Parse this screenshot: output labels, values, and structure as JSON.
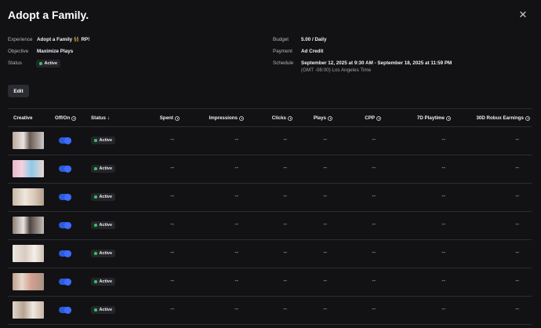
{
  "header": {
    "title": "Adopt a Family.",
    "close_icon": "close-icon"
  },
  "details": {
    "experience_label": "Experience",
    "experience_value": "Adopt a Family 👯 RP!",
    "objective_label": "Objective",
    "objective_value": "Maximize Plays",
    "status_label": "Status",
    "status_value": "Active",
    "budget_label": "Budget",
    "budget_value": "5.00 / Daily",
    "payment_label": "Payment",
    "payment_value": "Ad Credit",
    "schedule_label": "Schedule",
    "schedule_value": "September 12, 2025 at 9:30 AM - September 18, 2025 at 11:59 PM",
    "schedule_tz": "(GMT -08:00) Los Angeles Time"
  },
  "edit_label": "Edit",
  "table": {
    "columns": {
      "creative": "Creative",
      "onoff": "Off/On",
      "status": "Status",
      "spent": "Spent",
      "impressions": "Impressions",
      "clicks": "Clicks",
      "plays": "Plays",
      "cpp": "CPP",
      "playtime": "7D Playtime",
      "earnings": "30D Robux Earnings"
    },
    "rows": [
      {
        "status": "Active",
        "spent": "--",
        "impressions": "--",
        "clicks": "--",
        "plays": "--",
        "cpp": "--",
        "playtime": "--",
        "earnings": "--"
      },
      {
        "status": "Active",
        "spent": "--",
        "impressions": "--",
        "clicks": "--",
        "plays": "--",
        "cpp": "--",
        "playtime": "--",
        "earnings": "--"
      },
      {
        "status": "Active",
        "spent": "--",
        "impressions": "--",
        "clicks": "--",
        "plays": "--",
        "cpp": "--",
        "playtime": "--",
        "earnings": "--"
      },
      {
        "status": "Active",
        "spent": "--",
        "impressions": "--",
        "clicks": "--",
        "plays": "--",
        "cpp": "--",
        "playtime": "--",
        "earnings": "--"
      },
      {
        "status": "Active",
        "spent": "--",
        "impressions": "--",
        "clicks": "--",
        "plays": "--",
        "cpp": "--",
        "playtime": "--",
        "earnings": "--"
      },
      {
        "status": "Active",
        "spent": "--",
        "impressions": "--",
        "clicks": "--",
        "plays": "--",
        "cpp": "--",
        "playtime": "--",
        "earnings": "--"
      },
      {
        "status": "Active",
        "spent": "--",
        "impressions": "--",
        "clicks": "--",
        "plays": "--",
        "cpp": "--",
        "playtime": "--",
        "earnings": "--"
      }
    ]
  },
  "colors": {
    "background": "#121215",
    "toggle_on": "#3d6cff",
    "status_active": "#2cc95c"
  }
}
